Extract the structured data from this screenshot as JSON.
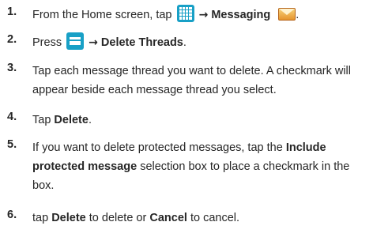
{
  "steps": [
    {
      "num": "1.",
      "prefix": "From the Home screen, tap",
      "arrow": "→",
      "bold": "Messaging",
      "suffix": "."
    },
    {
      "num": "2.",
      "prefix": "Press",
      "arrow": "→",
      "bold": "Delete Threads",
      "suffix": "."
    },
    {
      "num": "3.",
      "text": "Tap each message thread you want to delete. A checkmark will appear beside each message thread you select."
    },
    {
      "num": "4.",
      "prefix": "Tap",
      "bold": "Delete",
      "suffix": "."
    },
    {
      "num": "5.",
      "prefix": "If you want to delete protected messages, tap the",
      "bold": "Include protected message",
      "suffix": "selection box to place a checkmark in the box."
    },
    {
      "num": "6.",
      "prefix": "tap",
      "bold1": "Delete",
      "middle": "to delete or",
      "bold2": "Cancel",
      "suffix": "to cancel."
    }
  ],
  "icons": {
    "home_grid": "apps-grid-icon",
    "messaging": "messaging-envelope-icon",
    "menu": "menu-key-icon"
  },
  "colors": {
    "icon_blue": "#18a0c6",
    "text": "#262626"
  }
}
